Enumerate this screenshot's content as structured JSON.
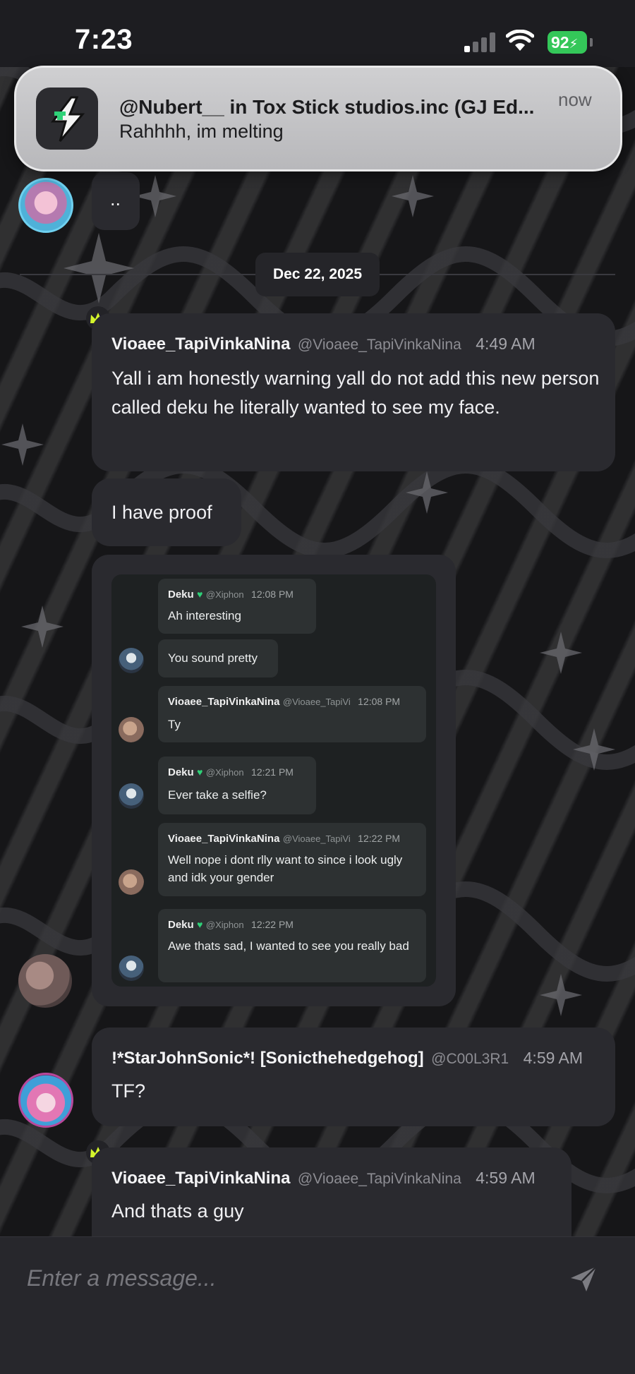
{
  "status_bar": {
    "time": "7:23",
    "battery": "92"
  },
  "notification": {
    "title": "@Nubert__ in Tox Stick studios.inc (GJ Ed...",
    "body": "Rahhhh, im melting",
    "time": "now"
  },
  "messages": {
    "top_partial": {
      "text": ".."
    },
    "date_divider": "Dec 22, 2025",
    "msg1": {
      "name": "Vioaee_TapiVinkaNina",
      "handle": "@Vioaee_TapiVinkaNina",
      "time": "4:49 AM",
      "text": "Yall i am honestly warning yall do not add this new person called deku he literally wanted to see my face."
    },
    "msg2": {
      "text": "I have proof"
    },
    "attachment": {
      "m1": {
        "name": "Deku",
        "handle": "@Xiphon",
        "time": "12:08 PM",
        "text": "Ah interesting"
      },
      "m2": {
        "text": "You sound pretty"
      },
      "m3": {
        "name": "Vioaee_TapiVinkaNina",
        "handle": "@Vioaee_TapiVi",
        "time": "12:08 PM",
        "text": "Ty"
      },
      "m4": {
        "name": "Deku",
        "handle": "@Xiphon",
        "time": "12:21 PM",
        "text": "Ever take a selfie?"
      },
      "m5": {
        "name": "Vioaee_TapiVinkaNina",
        "handle": "@Vioaee_TapiVi",
        "time": "12:22 PM",
        "text": "Well nope i dont rlly want to since i look ugly and idk your gender"
      },
      "m6": {
        "name": "Deku",
        "handle": "@Xiphon",
        "time": "12:22 PM",
        "text": "Awe thats sad, I wanted to see you really bad"
      }
    },
    "msg3": {
      "name": "!*StarJohnSonic*! [Sonicthehedgehog]",
      "handle": "@C00L3R1",
      "time": "4:59 AM",
      "text": "TF?"
    },
    "msg4": {
      "name": "Vioaee_TapiVinkaNina",
      "handle": "@Vioaee_TapiVinkaNina",
      "time": "4:59 AM",
      "text": "And thats a guy"
    }
  },
  "composer": {
    "placeholder": "Enter a message..."
  },
  "colors": {
    "accent_crown": "#d4f52c",
    "battery": "#34c759",
    "heart": "#2fd178"
  }
}
